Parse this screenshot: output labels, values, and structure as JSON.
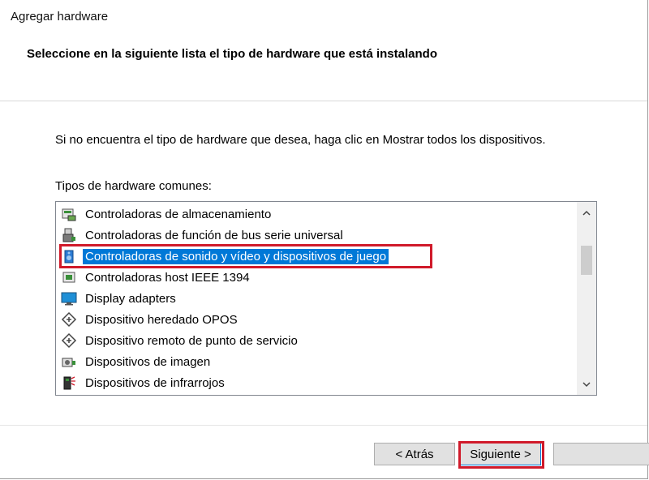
{
  "window": {
    "title": "Agregar hardware"
  },
  "header": {
    "heading": "Seleccione en la siguiente lista el tipo de hardware que está instalando"
  },
  "info_text": "Si no encuentra el tipo de hardware que desea, haga clic en Mostrar todos los dispositivos.",
  "list": {
    "label": "Tipos de hardware comunes:",
    "items": [
      {
        "label": "Controladoras de almacenamiento",
        "icon": "storage-controller-icon"
      },
      {
        "label": "Controladoras de función de bus serie universal",
        "icon": "usb-controller-icon"
      },
      {
        "label": "Controladoras de sonido y vídeo y dispositivos de juego",
        "icon": "speaker-icon",
        "selected": true
      },
      {
        "label": "Controladoras host IEEE 1394",
        "icon": "ieee1394-icon"
      },
      {
        "label": "Display adapters",
        "icon": "monitor-icon"
      },
      {
        "label": "Dispositivo heredado OPOS",
        "icon": "opos-device-icon"
      },
      {
        "label": "Dispositivo remoto de punto de servicio",
        "icon": "remote-pos-icon"
      },
      {
        "label": "Dispositivos de imagen",
        "icon": "camera-icon"
      },
      {
        "label": "Dispositivos de infrarrojos",
        "icon": "infrared-icon"
      }
    ]
  },
  "buttons": {
    "back": "< Atrás",
    "next": "Siguiente >",
    "cancel": ""
  },
  "colors": {
    "selection": "#0078d7",
    "annotation_highlight": "#d01a2a"
  }
}
